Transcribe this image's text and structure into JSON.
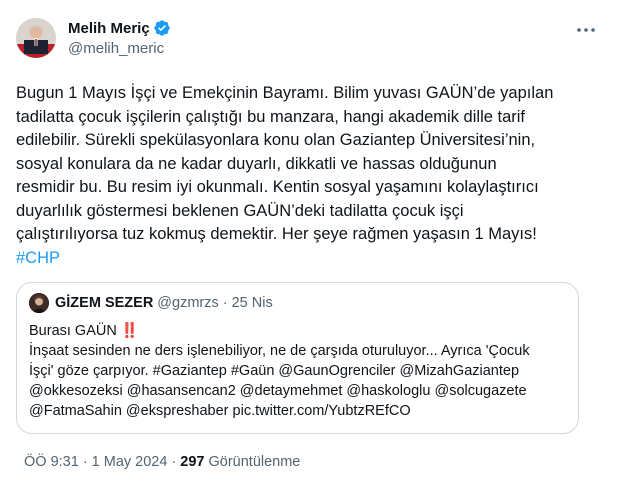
{
  "author": {
    "display_name": "Melih Meriç",
    "handle": "@melih_meric"
  },
  "tweet": {
    "lines": [
      "Bugun 1 Mayıs İşçi ve Emekçinin Bayramı. Bilim yuvası GAÜN’de yapılan",
      "tadilatta çocuk işçilerin çalıştığı bu manzara, hangi akademik dille tarif",
      "edilebilir. Sürekli spekülasyonlara konu olan Gaziantep Üniversitesi’nin,",
      "sosyal konulara da ne kadar duyarlı, dikkatli ve hassas olduğunun",
      "resmidir bu. Bu resim iyi okunmalı. Kentin sosyal yaşamını kolaylaştırıcı",
      "duyarlılık göstermesi beklenen GAÜN’deki tadilatta çocuk işçi",
      "çalıştırılıyorsa tuz kokmuş demektir. Her şeye rağmen yaşasın 1 Mayıs!"
    ],
    "hashtag": "#CHP"
  },
  "quote": {
    "display_name": "GİZEM SEZER",
    "handle": "@gzmrzs",
    "separator": "·",
    "date": "25 Nis",
    "first_line": "Burası GAÜN",
    "emoji": "‼️",
    "lines": [
      "İnşaat sesinden  ne ders işlenebiliyor, ne de çarşıda oturuluyor... Ayrıca 'Çocuk",
      "İşçi' göze çarpıyor. #Gaziantep #Gaün  @GaunOgrenciler @MizahGaziantep",
      "@okkesozeksi @hasansencan2 @detaymehmet @haskologlu @solcugazete",
      "@FatmaSahin @ekspreshaber pic.twitter.com/YubtzREfCO"
    ]
  },
  "footer": {
    "time": "ÖÖ 9:31",
    "separator": "·",
    "date": "1 May 2024",
    "separator2": "·",
    "views_count": "297",
    "views_label": "Görüntülenme"
  },
  "icons": {
    "verified": "verified-badge-icon",
    "more": "more-options-icon"
  },
  "colors": {
    "link": "#1d9bf0",
    "secondary": "#536471",
    "border": "#cfd9de",
    "emoji": "#d81b2c"
  }
}
